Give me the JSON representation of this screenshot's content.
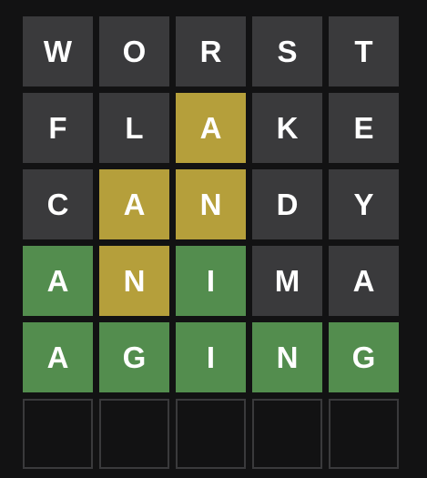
{
  "colors": {
    "background": "#121213",
    "absent": "#3a3a3c",
    "present": "#b59f3b",
    "correct": "#538d4e",
    "empty_border": "#3a3a3c",
    "letter": "#ffffff"
  },
  "board": {
    "rows": [
      {
        "letters": [
          "W",
          "O",
          "R",
          "S",
          "T"
        ],
        "states": [
          "absent",
          "absent",
          "absent",
          "absent",
          "absent"
        ]
      },
      {
        "letters": [
          "F",
          "L",
          "A",
          "K",
          "E"
        ],
        "states": [
          "absent",
          "absent",
          "present",
          "absent",
          "absent"
        ]
      },
      {
        "letters": [
          "C",
          "A",
          "N",
          "D",
          "Y"
        ],
        "states": [
          "absent",
          "present",
          "present",
          "absent",
          "absent"
        ]
      },
      {
        "letters": [
          "A",
          "N",
          "I",
          "M",
          "A"
        ],
        "states": [
          "correct",
          "present",
          "correct",
          "absent",
          "absent"
        ]
      },
      {
        "letters": [
          "A",
          "G",
          "I",
          "N",
          "G"
        ],
        "states": [
          "correct",
          "correct",
          "correct",
          "correct",
          "correct"
        ]
      },
      {
        "letters": [
          "",
          "",
          "",
          "",
          ""
        ],
        "states": [
          "empty",
          "empty",
          "empty",
          "empty",
          "empty"
        ]
      }
    ]
  }
}
